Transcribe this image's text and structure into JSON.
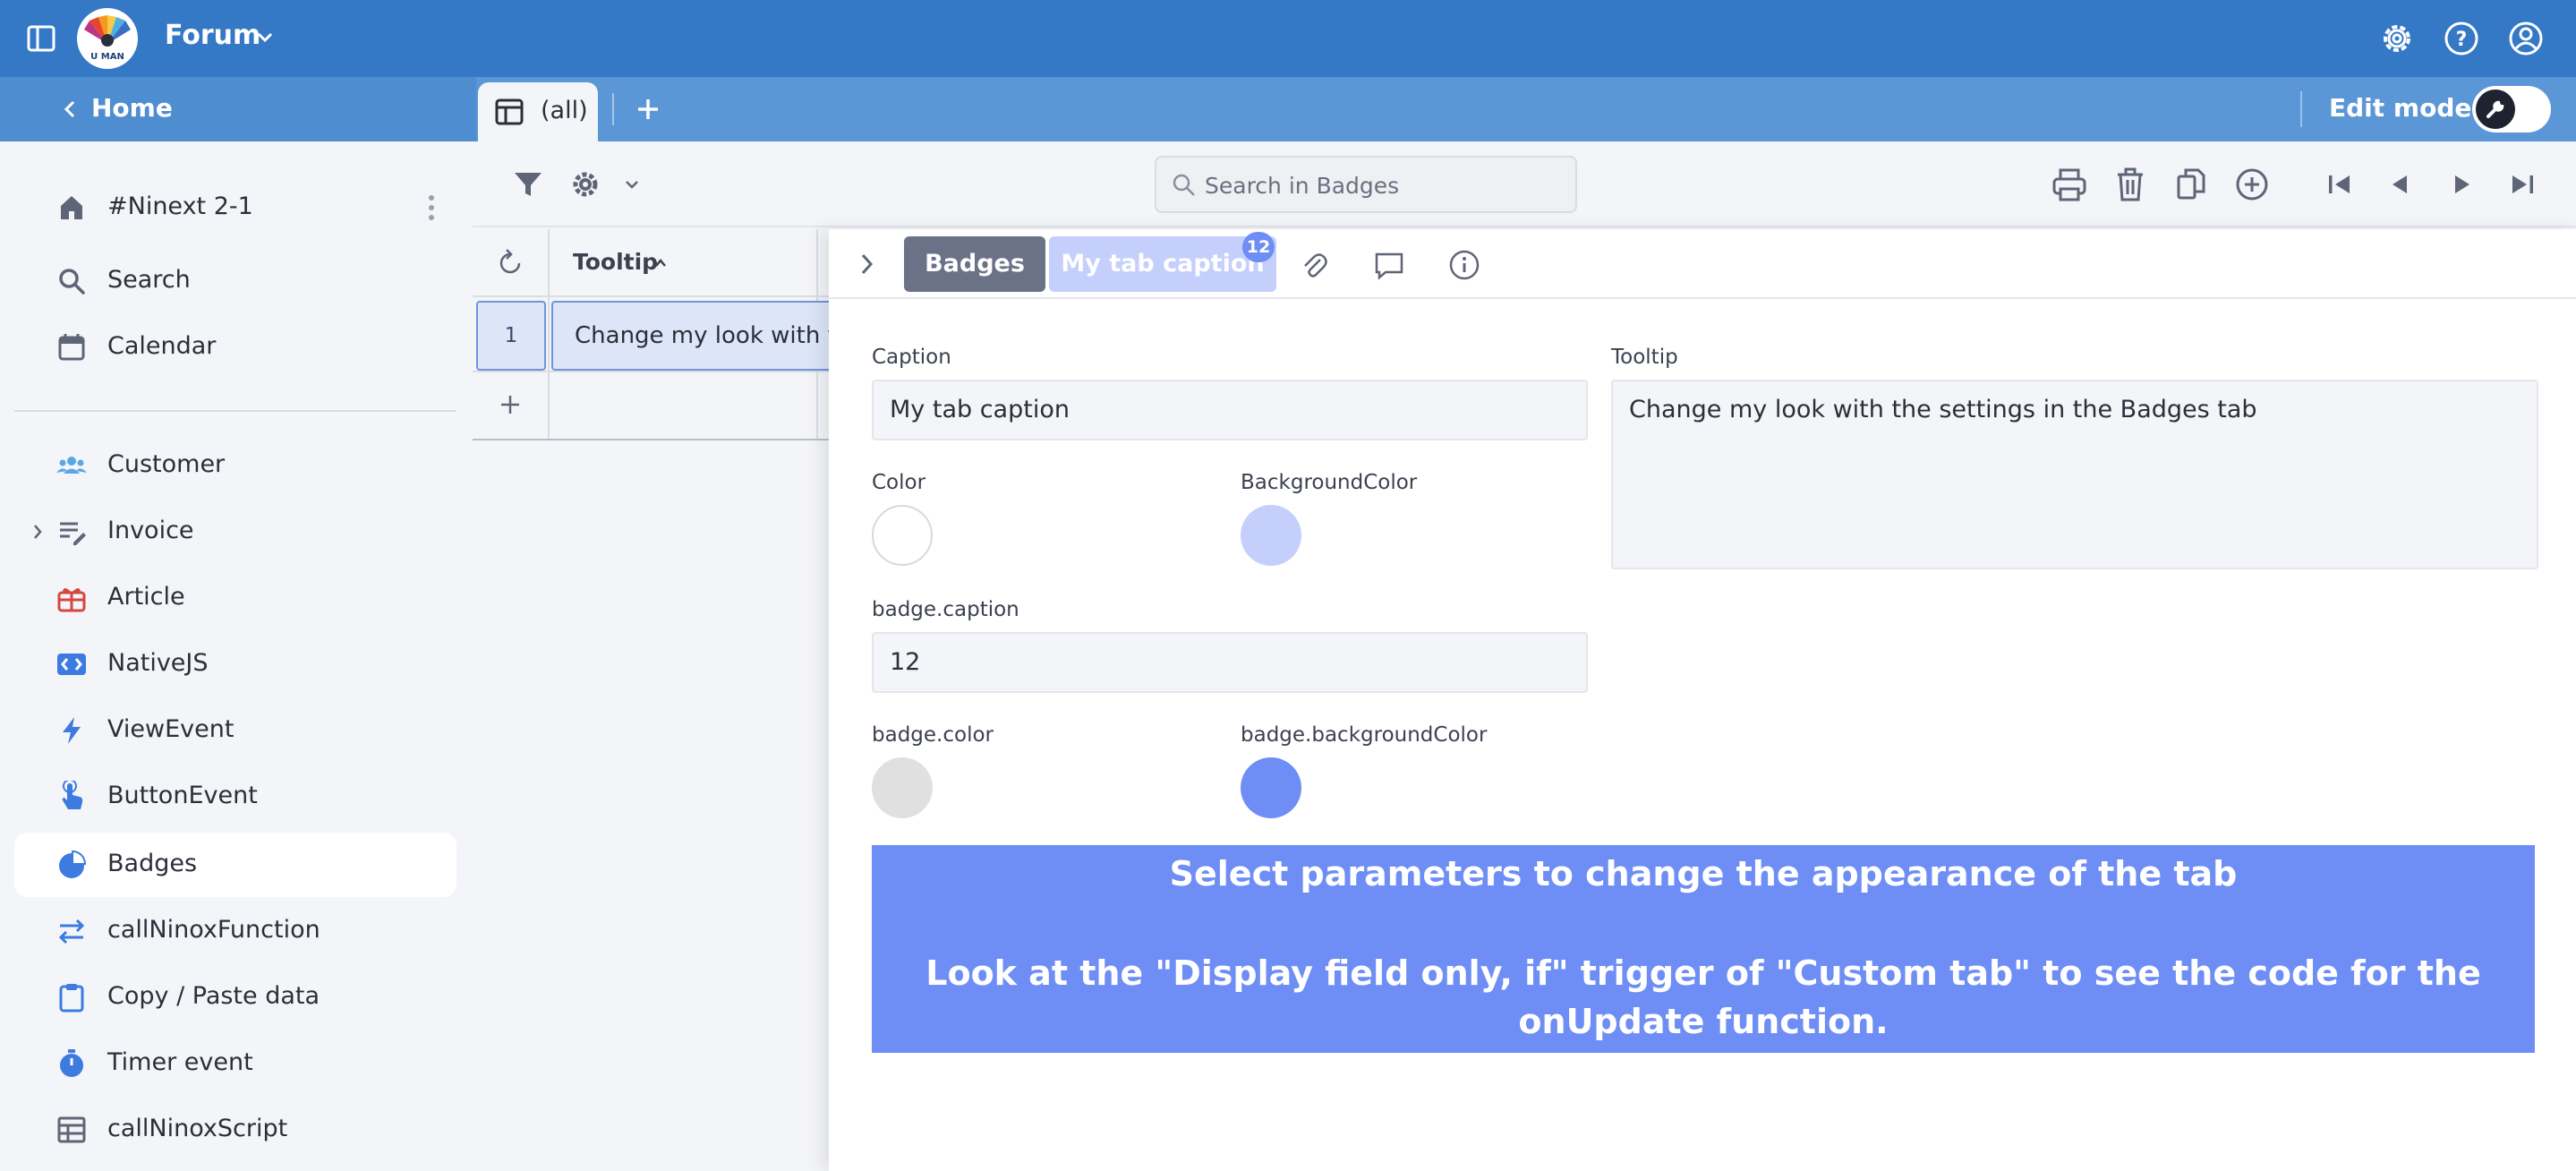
{
  "topbar": {
    "app_title": "Forum",
    "logo_text": "U MAN",
    "brand_color": "#3478c6",
    "icons": [
      "settings-icon",
      "help-icon",
      "account-icon"
    ]
  },
  "secbar": {
    "home_label": "Home",
    "view_tab_label": "(all)",
    "edit_mode_label": "Edit mode",
    "edit_mode_on": false
  },
  "sidebar": {
    "items": [
      {
        "label": "#Ninext 2-1",
        "icon": "home-icon"
      },
      {
        "label": "Search",
        "icon": "search-icon"
      },
      {
        "label": "Calendar",
        "icon": "calendar-icon"
      },
      {
        "label": "Customer",
        "icon": "people-icon"
      },
      {
        "label": "Invoice",
        "icon": "list-icon"
      },
      {
        "label": "Article",
        "icon": "gift-icon"
      },
      {
        "label": "NativeJS",
        "icon": "code-icon"
      },
      {
        "label": "ViewEvent",
        "icon": "lightning-icon"
      },
      {
        "label": "ButtonEvent",
        "icon": "tap-icon"
      },
      {
        "label": "Badges",
        "icon": "pie-icon"
      },
      {
        "label": "callNinoxFunction",
        "icon": "arrows-icon"
      },
      {
        "label": "Copy / Paste data",
        "icon": "clipboard-icon"
      },
      {
        "label": "Timer event",
        "icon": "timer-icon"
      },
      {
        "label": "callNinoxScript",
        "icon": "table-icon"
      }
    ],
    "active_item": "Badges"
  },
  "toolbar": {
    "search_placeholder": "Search in Badges"
  },
  "grid": {
    "column_header": "Tooltip",
    "rows": [
      {
        "number": "1",
        "tooltip": "Change my look with t"
      }
    ]
  },
  "panel": {
    "tabs": {
      "badges": "Badges",
      "custom": "My tab caption",
      "custom_badge": "12"
    },
    "fields": {
      "caption_label": "Caption",
      "caption_value": "My tab caption",
      "tooltip_label": "Tooltip",
      "tooltip_value": "Change my look with the settings in the Badges tab",
      "color_label": "Color",
      "color_value": "#ffffff",
      "bgcolor_label": "BackgroundColor",
      "bgcolor_value": "#c5cffc",
      "badge_caption_label": "badge.caption",
      "badge_caption_value": "12",
      "badge_color_label": "badge.color",
      "badge_color_value": "#e0e0e0",
      "badge_bgcolor_label": "badge.backgroundColor",
      "badge_bgcolor_value": "#6e8ef5"
    },
    "info": {
      "line1": "Select parameters to change the appearance of the tab",
      "line2": "Look at the \"Display field only, if\" trigger of \"Custom tab\"  to see the code for the onUpdate function."
    }
  }
}
